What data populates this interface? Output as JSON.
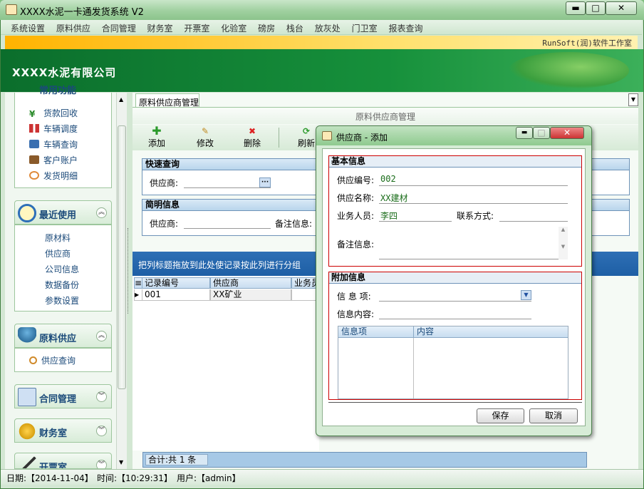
{
  "app": {
    "title": "XXXX水泥一卡通发货系统 V2",
    "min": "▬",
    "max": "□",
    "close": "✕"
  },
  "menu": [
    "系统设置",
    "原料供应",
    "合同管理",
    "财务室",
    "开票室",
    "化验室",
    "磅房",
    "栈台",
    "放灰处",
    "门卫室",
    "报表查询"
  ],
  "vendor": "RunSoft(润)软件工作室",
  "company": "XXXX水泥有限公司",
  "sidebar": {
    "common": {
      "title": "常用功能",
      "items": [
        {
          "label": "货款回收",
          "icon": "yen-icon"
        },
        {
          "label": "车辆调度",
          "icon": "dispatch-icon"
        },
        {
          "label": "车辆查询",
          "icon": "truck-icon"
        },
        {
          "label": "客户账户",
          "icon": "account-icon"
        },
        {
          "label": "发货明细",
          "icon": "delivery-icon"
        }
      ]
    },
    "recent": {
      "title": "最近使用",
      "items": [
        "原材料",
        "供应商",
        "公司信息",
        "数据备份",
        "参数设置"
      ]
    },
    "supply": {
      "title": "原料供应",
      "items": [
        {
          "label": "供应查询",
          "icon": "search-icon"
        }
      ]
    },
    "contract": {
      "title": "合同管理"
    },
    "finance": {
      "title": "财务室"
    },
    "invoice": {
      "title": "开票室"
    }
  },
  "main": {
    "tab": "原料供应商管理",
    "page_title": "原料供应商管理",
    "toolbar": {
      "add": "添加",
      "edit": "修改",
      "delete": "删除",
      "refresh": "刷新"
    },
    "quick": {
      "title": "快速查询",
      "supplier_label": "供应商:",
      "lookup": "···"
    },
    "brief": {
      "title": "简明信息",
      "supplier_label": "供应商:",
      "remark_label": "备注信息:"
    },
    "group_hint": "把列标题拖放到此处使记录按此列进行分组",
    "grid": {
      "columns": [
        "记录编号",
        "供应商",
        "业务员"
      ],
      "rows": [
        [
          "001",
          "XX矿业",
          ""
        ]
      ]
    },
    "summary": "合计:共 1 条"
  },
  "status": {
    "date": "日期:【2014-11-04】",
    "time": "时间:【10:29:31】",
    "user": "用户:【admin】"
  },
  "dialog": {
    "title": "供应商 - 添加",
    "basic": {
      "title": "基本信息",
      "code_label": "供应编号:",
      "code": "002",
      "name_label": "供应名称:",
      "name": "XX建材",
      "staff_label": "业务人员:",
      "staff": "李四",
      "contact_label": "联系方式:",
      "contact": "",
      "remark_label": "备注信息:"
    },
    "extra": {
      "title": "附加信息",
      "item_label": "信 息 项:",
      "content_label": "信息内容:",
      "columns": [
        "信息项",
        "内容"
      ]
    },
    "save": "保存",
    "cancel": "取消"
  }
}
